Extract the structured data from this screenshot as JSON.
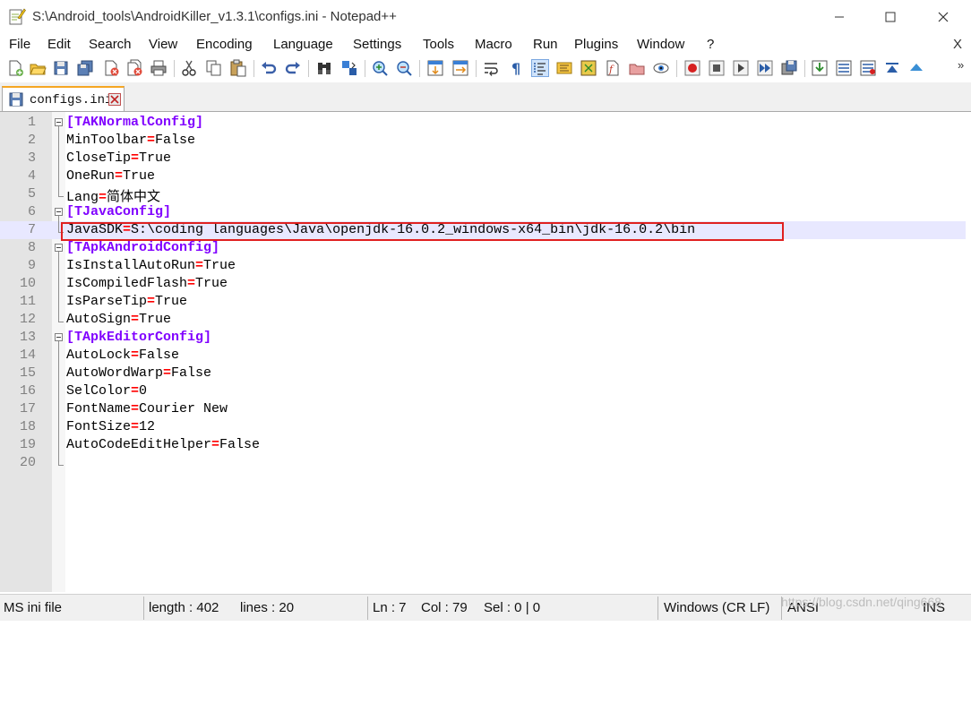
{
  "window": {
    "title": "S:\\Android_tools\\AndroidKiller_v1.3.1\\configs.ini - Notepad++",
    "menu_close": "X"
  },
  "menu": [
    "File",
    "Edit",
    "Search",
    "View",
    "Encoding",
    "Language",
    "Settings",
    "Tools",
    "Macro",
    "Run",
    "Plugins",
    "Window",
    "?"
  ],
  "toolbar": {
    "icons": [
      "new-file-icon",
      "open-file-icon",
      "save-icon",
      "save-all-icon",
      "close-icon",
      "close-all-icon",
      "print-icon",
      "cut-icon",
      "copy-icon",
      "paste-icon",
      "undo-icon",
      "redo-icon",
      "find-icon",
      "replace-icon",
      "zoom-in-icon",
      "zoom-out-icon",
      "sync-vertical-icon",
      "sync-horizontal-icon",
      "word-wrap-icon",
      "show-all-chars-icon",
      "indent-guide-icon",
      "doc-map-icon",
      "function-list-icon",
      "spell-check-icon",
      "folder-as-workspace-icon",
      "monitoring-icon",
      "record-macro-icon",
      "stop-record-icon",
      "playback-macro-icon",
      "run-macro-multiple-icon",
      "save-macro-icon",
      "download-icon",
      "lines-icon",
      "lines-check-icon",
      "scroll-top-icon",
      "arrow-up-icon"
    ],
    "overflow": "»"
  },
  "tab": {
    "label": "configs.ini",
    "active": true
  },
  "editor": {
    "current_line": 7,
    "lines": [
      {
        "n": "1",
        "key": "",
        "eq": "",
        "val": "",
        "sec": "[TAKNormalConfig]"
      },
      {
        "n": "2",
        "key": "MinToolbar",
        "eq": "=",
        "val": "False",
        "sec": ""
      },
      {
        "n": "3",
        "key": "CloseTip",
        "eq": "=",
        "val": "True",
        "sec": ""
      },
      {
        "n": "4",
        "key": "OneRun",
        "eq": "=",
        "val": "True",
        "sec": ""
      },
      {
        "n": "5",
        "key": "Lang",
        "eq": "=",
        "val": "简体中文",
        "sec": ""
      },
      {
        "n": "6",
        "key": "",
        "eq": "",
        "val": "",
        "sec": "[TJavaConfig]"
      },
      {
        "n": "7",
        "key": "JavaSDK",
        "eq": "=",
        "val": "S:\\coding languages\\Java\\openjdk-16.0.2_windows-x64_bin\\jdk-16.0.2\\bin",
        "sec": ""
      },
      {
        "n": "8",
        "key": "",
        "eq": "",
        "val": "",
        "sec": "[TApkAndroidConfig]"
      },
      {
        "n": "9",
        "key": "IsInstallAutoRun",
        "eq": "=",
        "val": "True",
        "sec": ""
      },
      {
        "n": "10",
        "key": "IsCompiledFlash",
        "eq": "=",
        "val": "True",
        "sec": ""
      },
      {
        "n": "11",
        "key": "IsParseTip",
        "eq": "=",
        "val": "True",
        "sec": ""
      },
      {
        "n": "12",
        "key": "AutoSign",
        "eq": "=",
        "val": "True",
        "sec": ""
      },
      {
        "n": "13",
        "key": "",
        "eq": "",
        "val": "",
        "sec": "[TApkEditorConfig]"
      },
      {
        "n": "14",
        "key": "AutoLock",
        "eq": "=",
        "val": "False",
        "sec": ""
      },
      {
        "n": "15",
        "key": "AutoWordWarp",
        "eq": "=",
        "val": "False",
        "sec": ""
      },
      {
        "n": "16",
        "key": "SelColor",
        "eq": "=",
        "val": "0",
        "sec": ""
      },
      {
        "n": "17",
        "key": "FontName",
        "eq": "=",
        "val": "Courier New",
        "sec": ""
      },
      {
        "n": "18",
        "key": "FontSize",
        "eq": "=",
        "val": "12",
        "sec": ""
      },
      {
        "n": "19",
        "key": "AutoCodeEditHelper",
        "eq": "=",
        "val": "False",
        "sec": ""
      },
      {
        "n": "20",
        "key": "",
        "eq": "",
        "val": "",
        "sec": ""
      }
    ]
  },
  "status": {
    "filetype": "MS ini file",
    "length": "length : 402",
    "lines": "lines : 20",
    "ln": "Ln : 7",
    "col": "Col : 79",
    "sel": "Sel : 0 | 0",
    "eol": "Windows (CR LF)",
    "encoding": "ANSI",
    "mode": "INS"
  },
  "watermark": "https://blog.csdn.net/qing668",
  "colors": {
    "section": "#8000ff",
    "operator": "#ff0000",
    "current_line": "#e8e8ff",
    "highlight_box": "#e02020",
    "tab_accent": "#f5a623"
  }
}
